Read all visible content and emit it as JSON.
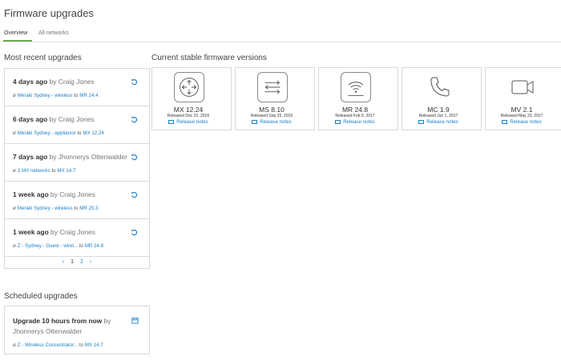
{
  "page": {
    "title": "Firmware upgrades"
  },
  "tabs": [
    {
      "label": "Overview",
      "active": true
    },
    {
      "label": "All networks",
      "active": false
    }
  ],
  "colors": {
    "link": "#1a7fc7",
    "active_tab_underline": "#6aa84f"
  },
  "recent": {
    "heading": "Most recent upgrades",
    "items": [
      {
        "when": "4 days ago",
        "by": "by Craig Jones",
        "network": "Meraki Sydney - wireless",
        "to": "to",
        "version": "MR 24.4"
      },
      {
        "when": "6 days ago",
        "by": "by Craig Jones",
        "network": "Meraki Sydney - appliance",
        "to": "to",
        "version": "MX 12.24"
      },
      {
        "when": "7 days ago",
        "by": "by Jhonnerys Ottenwalder",
        "network": "3 MX networks",
        "to": "to",
        "version": "MX 14.7"
      },
      {
        "when": "1 week ago",
        "by": "by Craig Jones",
        "network": "Meraki Sydney - wireless",
        "to": "to",
        "version": "MR 25.3"
      },
      {
        "when": "1 week ago",
        "by": "by Craig Jones",
        "network": "Z - Sydney - Guest - wirel...",
        "to": "to",
        "version": "MR 24.8"
      }
    ],
    "pager": {
      "prev": "‹",
      "pages": [
        "1",
        "2"
      ],
      "next": "›"
    }
  },
  "scheduled": {
    "heading": "Scheduled upgrades",
    "item": {
      "when": "Upgrade 10 hours from now",
      "by": "by Jhonnerys Ottenwalder",
      "network": "Z - Wireless Concentrator...",
      "to": "to",
      "version": "MX 14.7"
    }
  },
  "current": {
    "heading": "Current stable firmware versions",
    "notes_label": "Release notes",
    "cards": [
      {
        "name": "MX 12.24",
        "released": "Released Dec 22, 2016",
        "icon": "router-icon"
      },
      {
        "name": "MS 8.10",
        "released": "Released Sep 26, 2016",
        "icon": "switch-icon"
      },
      {
        "name": "MR 24.8",
        "released": "Released Feb 9, 2017",
        "icon": "wireless-icon"
      },
      {
        "name": "MC 1.9",
        "released": "Released Jun 1, 2017",
        "icon": "phone-icon"
      },
      {
        "name": "MV 2.1",
        "released": "Released May 23, 2017",
        "icon": "camera-icon"
      }
    ]
  }
}
